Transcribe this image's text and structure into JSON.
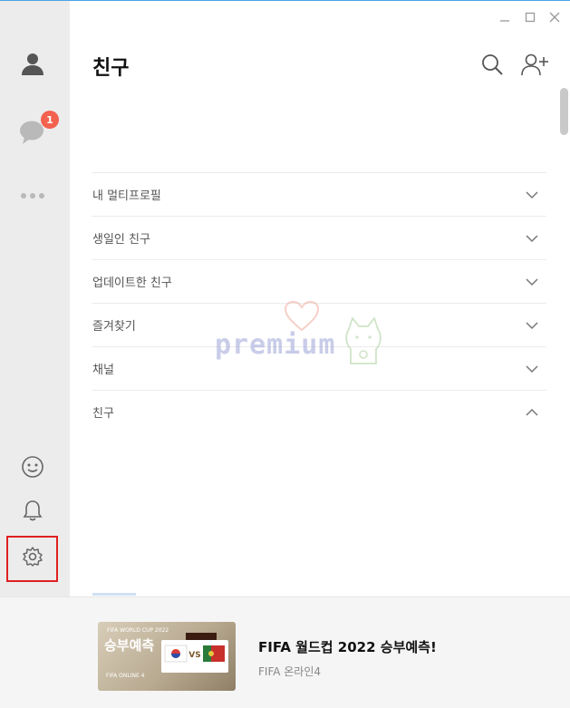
{
  "window": {
    "controls": [
      "minimize",
      "maximize",
      "close"
    ]
  },
  "sidebar": {
    "top_items": [
      {
        "name": "friends",
        "icon": "person-icon"
      },
      {
        "name": "chats",
        "icon": "chat-bubble-icon",
        "badge": "1"
      },
      {
        "name": "more",
        "icon": "more-dots-icon"
      }
    ],
    "bottom_items": [
      {
        "name": "emoticon",
        "icon": "smiley-icon"
      },
      {
        "name": "notifications",
        "icon": "bell-icon"
      },
      {
        "name": "settings",
        "icon": "gear-icon"
      }
    ],
    "colors": {
      "background": "#ececec",
      "badge": "#f3614f",
      "highlight": "#e02020"
    }
  },
  "header": {
    "title": "친구"
  },
  "sections": [
    {
      "label": "내 멀티프로필",
      "expanded": false
    },
    {
      "label": "생일인 친구",
      "expanded": false
    },
    {
      "label": "업데이트한 친구",
      "expanded": false
    },
    {
      "label": "즐겨찾기",
      "expanded": false
    },
    {
      "label": "채널",
      "expanded": false
    },
    {
      "label": "친구",
      "expanded": true
    }
  ],
  "watermark": {
    "text": "premium"
  },
  "ad": {
    "title": "FIFA 월드컵 2022 승부예측!",
    "subtitle": "FIFA 온라인4",
    "thumb": {
      "line1": "FIFA WORLD CUP 2022",
      "headline": "승부예측",
      "footer": "FIFA ONLINE 4",
      "vs": "VS"
    }
  }
}
